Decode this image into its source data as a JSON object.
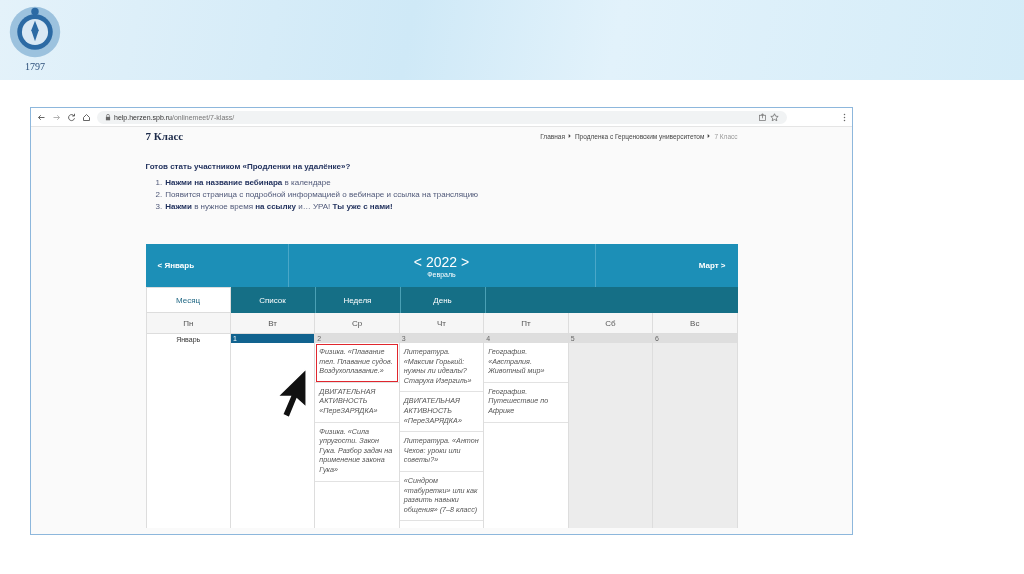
{
  "slide": {
    "year_mark": "1797"
  },
  "browser": {
    "url_host": "help.herzen.spb.ru",
    "url_path": "/onlinemeet/7-klass/"
  },
  "page": {
    "title": "7 Класс",
    "breadcrumbs": [
      {
        "label": "Главная",
        "current": false
      },
      {
        "label": "Продленка с Герценовским университетом",
        "current": false
      },
      {
        "label": "7 Класс",
        "current": true
      }
    ],
    "question": "Готов стать участником «Продленки на удалёнке»?",
    "steps": [
      {
        "number": "1.",
        "text": "**Нажми на название вебинара** в календаре"
      },
      {
        "number": "2.",
        "text": "Появится страница с подробной информацией о вебинаре и ссылка на трансляцию"
      },
      {
        "number": "3.",
        "text": "**Нажми** в нужное время **на ссылку** и… УРА! **Ты уже с нами!**"
      }
    ]
  },
  "calendar": {
    "prev": "< Январь",
    "year": "< 2022 >",
    "month": "Февраль",
    "next": "Март >",
    "views": [
      {
        "label": "Месяц",
        "selected": true
      },
      {
        "label": "Список",
        "selected": false
      },
      {
        "label": "Неделя",
        "selected": false
      },
      {
        "label": "День",
        "selected": false
      }
    ],
    "weekdays": [
      "Пн",
      "Вт",
      "Ср",
      "Чт",
      "Пт",
      "Сб",
      "Вс"
    ],
    "week_label": "Январь",
    "days": [
      {
        "number": "1",
        "today": true,
        "weekend": false
      },
      {
        "number": "2",
        "today": false,
        "weekend": false,
        "events": [
          {
            "text": "Физика. «Плавание тел. Плавание судов. Воздухоплавание.»",
            "highlighted": true
          },
          {
            "text": "ДВИГАТЕЛЬНАЯ АКТИВНОСТЬ «ПереЗАРЯДКА»",
            "highlighted": false
          },
          {
            "text": "Физика. «Сила упругости. Закон Гука. Разбор задач на применение закона Гука»",
            "highlighted": false
          }
        ]
      },
      {
        "number": "3",
        "today": false,
        "weekend": false,
        "events": [
          {
            "text": "Литература. «Максим Горький: нужны ли идеалы? Старуха Изергиль»",
            "highlighted": false
          },
          {
            "text": "ДВИГАТЕЛЬНАЯ АКТИВНОСТЬ «ПереЗАРЯДКА»",
            "highlighted": false
          },
          {
            "text": "Литература. «Антон Чехов: уроки или советы?»",
            "highlighted": false
          },
          {
            "text": "«Синдром «табуретки» или как развить навыки общения» (7–8 класс)",
            "highlighted": false
          }
        ]
      },
      {
        "number": "4",
        "today": false,
        "weekend": false,
        "events": [
          {
            "text": "География. «Австралия. Животный мир»",
            "highlighted": false
          },
          {
            "text": "География. Путешествие по Африке",
            "highlighted": false
          }
        ]
      },
      {
        "number": "5",
        "today": false,
        "weekend": true
      },
      {
        "number": "6",
        "today": false,
        "weekend": true
      }
    ]
  }
}
